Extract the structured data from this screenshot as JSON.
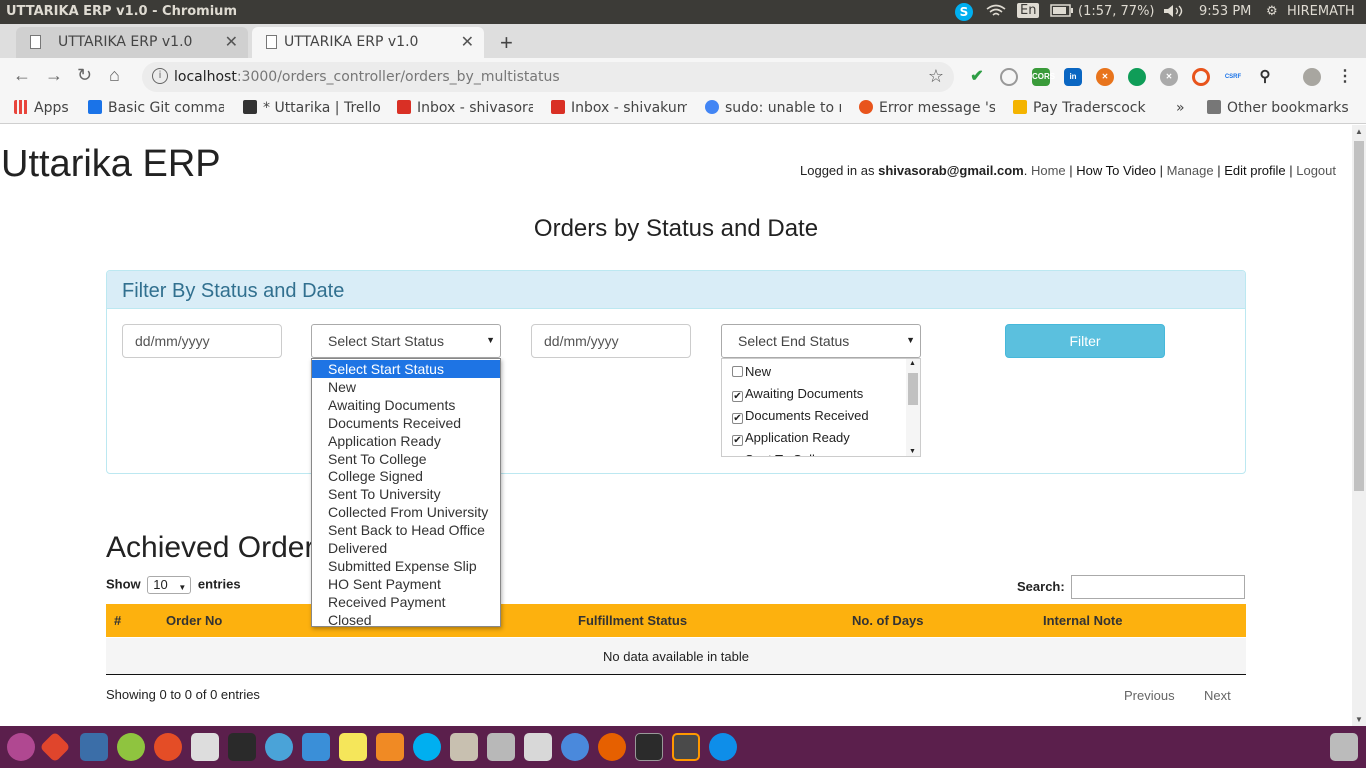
{
  "system": {
    "window_title": "UTTARIKA ERP v1.0 - Chromium",
    "lang": "En",
    "battery": "(1:57, 77%)",
    "clock": "9:53 PM",
    "user": "HIREMATH"
  },
  "browser": {
    "tabs": [
      {
        "label": "UTTARIKA ERP v1.0"
      },
      {
        "label": "UTTARIKA ERP v1.0"
      }
    ],
    "url_host": "localhost",
    "url_path": ":3000/orders_controller/orders_by_multistatus",
    "bookmarks": [
      {
        "label": "Apps",
        "color": "#e8453c"
      },
      {
        "label": "Basic Git comma",
        "color": "#1a73e8"
      },
      {
        "label": "* Uttarika | Trello",
        "color": "#333333"
      },
      {
        "label": "Inbox - shivasora",
        "color": "#d93025"
      },
      {
        "label": "Inbox - shivakum",
        "color": "#d93025"
      },
      {
        "label": "sudo: unable to r",
        "color": "#4285f4"
      },
      {
        "label": "Error message 's",
        "color": "#e8541c"
      },
      {
        "label": "Pay Traderscock",
        "color": "#f4b400"
      }
    ],
    "more_bookmarks": "»",
    "other_bookmarks": "Other bookmarks"
  },
  "header": {
    "brand": "Uttarika ERP",
    "logged_prefix": "Logged in as",
    "email": "shivasorab@gmail.com",
    "links": [
      "Home",
      "How To Video",
      "Manage",
      "Edit profile",
      "Logout"
    ]
  },
  "page_title": "Orders by Status and Date",
  "filter": {
    "panel_title": "Filter By Status and Date",
    "start_date_placeholder": "dd/mm/yyyy",
    "end_date_placeholder": "dd/mm/yyyy",
    "start_status_selected": "Select Start Status",
    "end_status_selected": "Select End Status",
    "filter_button": "Filter",
    "start_status_options": [
      "Select Start Status",
      "New",
      "Awaiting Documents",
      "Documents Received",
      "Application Ready",
      "Sent To College",
      "College Signed",
      "Sent To University",
      "Collected From University",
      "Sent Back to Head Office",
      "Delivered",
      "Submitted Expense Slip",
      "HO Sent Payment",
      "Received Payment",
      "Closed"
    ],
    "end_status_items": [
      {
        "label": "New",
        "checked": false
      },
      {
        "label": "Awaiting Documents",
        "checked": true
      },
      {
        "label": "Documents Received",
        "checked": true
      },
      {
        "label": "Application Ready",
        "checked": true
      },
      {
        "label": "Sent To College",
        "checked": true
      }
    ]
  },
  "achieved": {
    "heading": "Achieved Order",
    "show_label": "Show",
    "entries_value": "10",
    "entries_label": "entries",
    "search_label": "Search:",
    "columns": [
      "#",
      "Order No",
      "Fulfillment Status",
      "No. of Days",
      "Internal Note"
    ],
    "empty_message": "No data available in table",
    "info": "Showing 0 to 0 of 0 entries",
    "prev": "Previous",
    "next": "Next"
  }
}
